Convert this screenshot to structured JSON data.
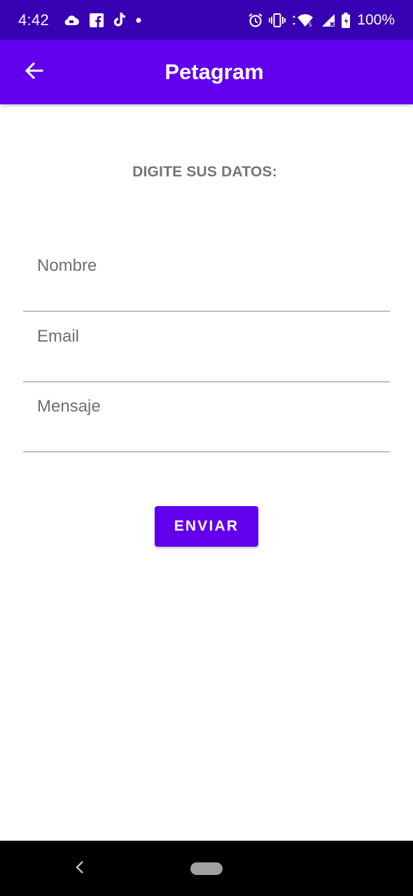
{
  "status_bar": {
    "time": "4:42",
    "battery": "100%",
    "left_icons": [
      "cloud-icon",
      "facebook-icon",
      "tiktok-icon",
      "notification-dot-icon"
    ],
    "right_icons": [
      "alarm-icon",
      "vibrate-icon",
      "wifi-icon",
      "cell-signal-icon",
      "battery-icon"
    ],
    "background": "#3700b3"
  },
  "app_bar": {
    "title": "Petagram",
    "back_icon": "arrow-back-icon",
    "background": "#6200ee"
  },
  "form": {
    "heading": "DIGITE SUS DATOS:",
    "fields": [
      {
        "name": "nombre",
        "placeholder": "Nombre",
        "value": ""
      },
      {
        "name": "email",
        "placeholder": "Email",
        "value": ""
      },
      {
        "name": "mensaje",
        "placeholder": "Mensaje",
        "value": ""
      }
    ],
    "submit_label": "ENVIAR",
    "accent": "#6200ee"
  },
  "nav_bar": {
    "back_icon": "chevron-left-icon",
    "home_icon": "home-pill-icon"
  }
}
